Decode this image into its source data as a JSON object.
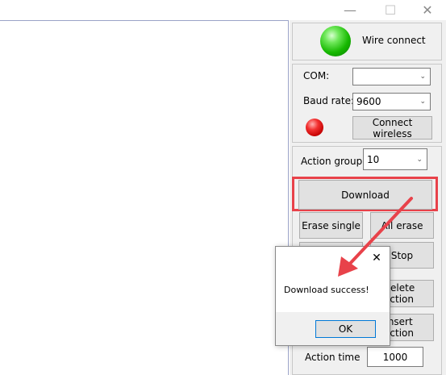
{
  "window": {
    "minimize_icon": "minimize-icon",
    "maximize_icon": "maximize-icon",
    "close_icon": "close-icon",
    "minimize_glyph": "—",
    "maximize_glyph": "☐",
    "close_glyph": "✕"
  },
  "wire": {
    "status_label": "Wire connect",
    "led_color": "#16b800"
  },
  "wireless": {
    "com_label": "COM:",
    "com_value": "",
    "baud_label": "Baud rate:",
    "baud_value": "9600",
    "led_color": "#c20000",
    "connect_button": "Connect wireless"
  },
  "actions": {
    "group_label": "Action group",
    "group_value": "10",
    "download_button": "Download",
    "erase_single_button": "Erase single",
    "all_erase_button": "All erase",
    "run_button": "",
    "stop_button": "Stop",
    "delete_action_button": "Delete action",
    "insert_action_button": "Insert action",
    "action_time_label": "Action time",
    "action_time_value": "1000"
  },
  "dialog": {
    "message": "Download success!",
    "ok_button": "OK",
    "close_glyph": "✕"
  },
  "annotation": {
    "highlight_color": "#e8424a",
    "arrow_color": "#e8424a"
  }
}
